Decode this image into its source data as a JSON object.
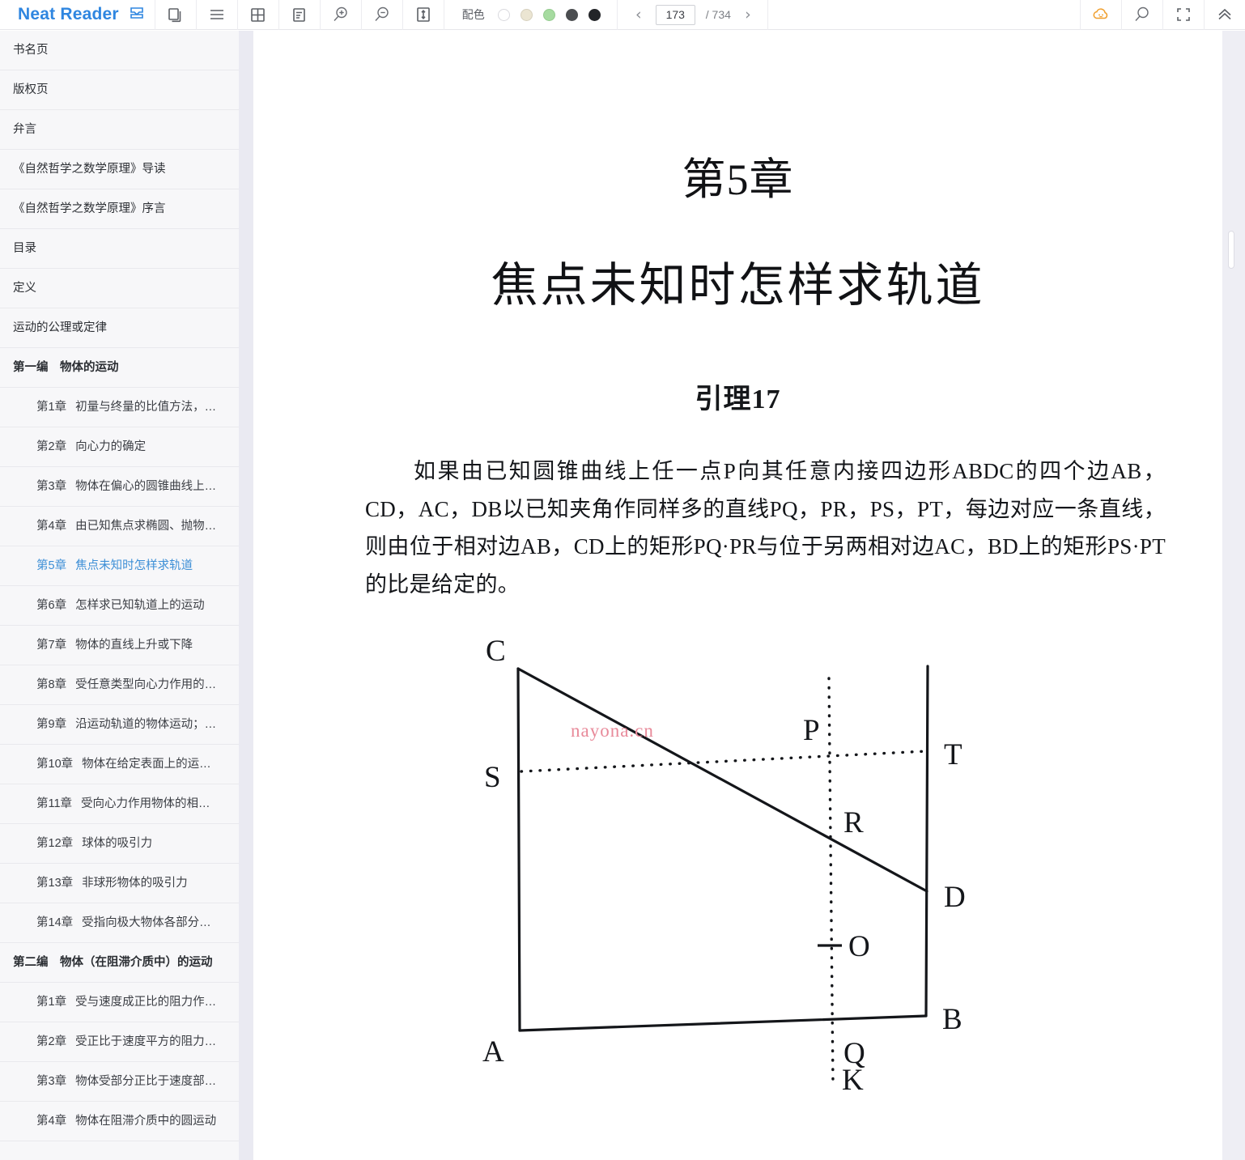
{
  "toolbar": {
    "brand": "Neat Reader",
    "icons": [
      {
        "name": "save-to-shelf-icon",
        "label": "保存"
      },
      {
        "name": "copy-icon",
        "label": "复制"
      },
      {
        "name": "menu-icon",
        "label": "目录"
      },
      {
        "name": "grid-icon",
        "label": "网格"
      },
      {
        "name": "notes-icon",
        "label": "笔记"
      },
      {
        "name": "zoom-in-icon",
        "label": "放大"
      },
      {
        "name": "zoom-out-icon",
        "label": "缩小"
      },
      {
        "name": "line-height-icon",
        "label": "行距"
      }
    ],
    "color_scheme": {
      "label": "配色",
      "swatches": [
        {
          "name": "swatch-white",
          "color": "#ffffff",
          "border": "#d9d9de"
        },
        {
          "name": "swatch-cream",
          "color": "#ebe5d2",
          "border": "#d6d0bd"
        },
        {
          "name": "swatch-green",
          "color": "#a6dba0",
          "border": "#93cb8d"
        },
        {
          "name": "swatch-dark-gray",
          "color": "#4b4d50",
          "border": "#4b4d50"
        },
        {
          "name": "swatch-black",
          "color": "#232528",
          "border": "#232528"
        }
      ]
    },
    "pager": {
      "prev": "‹",
      "next": "›",
      "current_page": "173",
      "total_label": "/ 734",
      "total_pages": "734"
    },
    "right_icons": [
      {
        "name": "cloud-sync-icon",
        "color": "#f0a030"
      },
      {
        "name": "search-icon",
        "color": "#5d6066"
      },
      {
        "name": "fullscreen-icon",
        "color": "#5d6066"
      },
      {
        "name": "collapse-up-icon",
        "color": "#5d6066"
      }
    ]
  },
  "sidebar": {
    "items": [
      {
        "level": 0,
        "type": "plain",
        "label": "书名页",
        "active": false
      },
      {
        "level": 0,
        "type": "plain",
        "label": "版权页",
        "active": false
      },
      {
        "level": 0,
        "type": "plain",
        "label": "弁言",
        "active": false
      },
      {
        "level": 0,
        "type": "plain",
        "label": "《自然哲学之数学原理》导读",
        "active": false
      },
      {
        "level": 0,
        "type": "plain",
        "label": "《自然哲学之数学原理》序言",
        "active": false
      },
      {
        "level": 0,
        "type": "plain",
        "label": "目录",
        "active": false
      },
      {
        "level": 0,
        "type": "plain",
        "label": "定义",
        "active": false
      },
      {
        "level": 0,
        "type": "plain",
        "label": "运动的公理或定律",
        "active": false
      },
      {
        "level": 0,
        "type": "part",
        "label": "第一编　物体的运动",
        "active": false
      },
      {
        "level": 1,
        "type": "chapter",
        "num": "第1章",
        "title": "初量与终量的比值方法，…",
        "active": false
      },
      {
        "level": 1,
        "type": "chapter",
        "num": "第2章",
        "title": "向心力的确定",
        "active": false
      },
      {
        "level": 1,
        "type": "chapter",
        "num": "第3章",
        "title": "物体在偏心的圆锥曲线上…",
        "active": false
      },
      {
        "level": 1,
        "type": "chapter",
        "num": "第4章",
        "title": "由已知焦点求椭圆、抛物…",
        "active": false
      },
      {
        "level": 1,
        "type": "chapter",
        "num": "第5章",
        "title": "焦点未知时怎样求轨道",
        "active": true
      },
      {
        "level": 1,
        "type": "chapter",
        "num": "第6章",
        "title": "怎样求已知轨道上的运动",
        "active": false
      },
      {
        "level": 1,
        "type": "chapter",
        "num": "第7章",
        "title": "物体的直线上升或下降",
        "active": false
      },
      {
        "level": 1,
        "type": "chapter",
        "num": "第8章",
        "title": "受任意类型向心力作用的…",
        "active": false
      },
      {
        "level": 1,
        "type": "chapter",
        "num": "第9章",
        "title": "沿运动轨道的物体运动；…",
        "active": false
      },
      {
        "level": 1,
        "type": "chapter",
        "num": "第10章",
        "title": "物体在给定表面上的运…",
        "active": false
      },
      {
        "level": 1,
        "type": "chapter",
        "num": "第11章",
        "title": "受向心力作用物体的相…",
        "active": false
      },
      {
        "level": 1,
        "type": "chapter",
        "num": "第12章",
        "title": "球体的吸引力",
        "active": false
      },
      {
        "level": 1,
        "type": "chapter",
        "num": "第13章",
        "title": "非球形物体的吸引力",
        "active": false
      },
      {
        "level": 1,
        "type": "chapter",
        "num": "第14章",
        "title": "受指向极大物体各部分…",
        "active": false
      },
      {
        "level": 0,
        "type": "part",
        "label": "第二编　物体（在阻滞介质中）的运动",
        "active": false
      },
      {
        "level": 1,
        "type": "chapter",
        "num": "第1章",
        "title": "受与速度成正比的阻力作…",
        "active": false
      },
      {
        "level": 1,
        "type": "chapter",
        "num": "第2章",
        "title": "受正比于速度平方的阻力…",
        "active": false
      },
      {
        "level": 1,
        "type": "chapter",
        "num": "第3章",
        "title": "物体受部分正比于速度部…",
        "active": false
      },
      {
        "level": 1,
        "type": "chapter",
        "num": "第4章",
        "title": "物体在阻滞介质中的圆运动",
        "active": false
      }
    ]
  },
  "content": {
    "chapter_number": "第5章",
    "chapter_title": "焦点未知时怎样求轨道",
    "lemma_title": "引理17",
    "paragraph": "如果由已知圆锥曲线上任一点P向其任意内接四边形ABDC的四个边AB，CD，AC，DB以已知夹角作同样多的直线PQ，PR，PS，PT，每边对应一条直线，则由位于相对边AB，CD上的矩形PQ·PR与位于另两相对边AC，BD上的矩形PS·PT的比是给定的。",
    "watermark": "nayona.cn",
    "figure": {
      "name": "lemma-17-diagram",
      "labels": [
        "C",
        "S",
        "P",
        "T",
        "R",
        "D",
        "O",
        "A",
        "Q",
        "B",
        "K"
      ],
      "solid_lines": [
        "C-A",
        "C-D",
        "A-B",
        "B-top-right-vertical"
      ],
      "dotted_lines": [
        "S-T",
        "P-K vertical"
      ]
    }
  }
}
